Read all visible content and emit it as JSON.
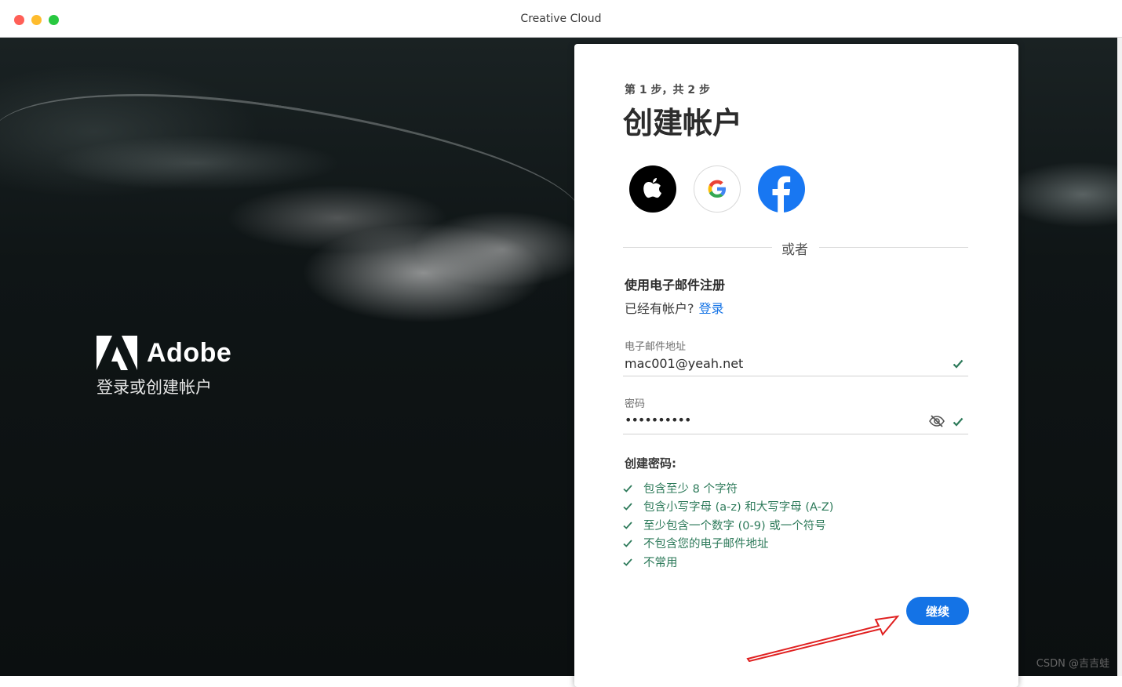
{
  "window": {
    "title": "Creative Cloud"
  },
  "brand": {
    "name": "Adobe",
    "tagline": "登录或创建帐户"
  },
  "card": {
    "step": "第 1 步，共 2 步",
    "heading": "创建帐户",
    "social": [
      "apple-icon",
      "google-icon",
      "facebook-icon"
    ],
    "divider": "或者",
    "email_signup": "使用电子邮件注册",
    "have_account": "已经有帐户?",
    "login_link": "登录",
    "email": {
      "label": "电子邮件地址",
      "value": "mac001@yeah.net"
    },
    "password": {
      "label": "密码",
      "value": "••••••••••"
    },
    "password_rules_title": "创建密码:",
    "password_rules": [
      "包含至少 8 个字符",
      "包含小写字母 (a-z) 和大写字母 (A-Z)",
      "至少包含一个数字 (0-9) 或一个符号",
      "不包含您的电子邮件地址",
      "不常用"
    ],
    "continue_label": "继续"
  },
  "colors": {
    "accent": "#1473e6",
    "valid": "#2d7a5a",
    "facebook": "#1877f2"
  },
  "watermark": "CSDN @吉吉蛙"
}
